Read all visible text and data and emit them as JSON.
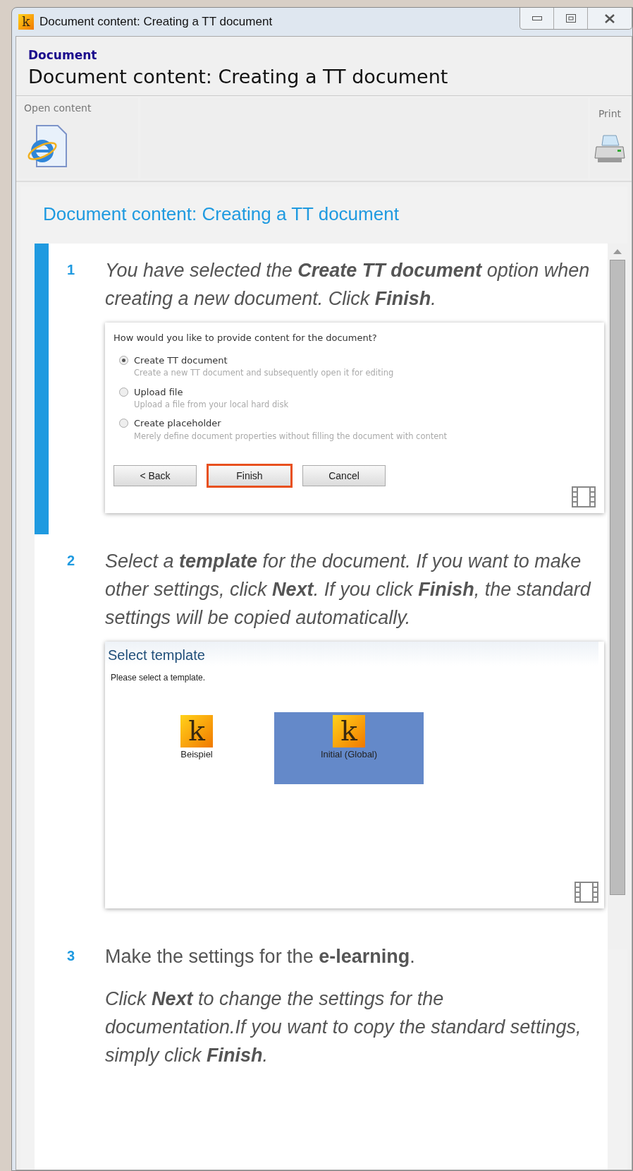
{
  "window": {
    "icon_letter": "k",
    "title": "Document content: Creating a TT document"
  },
  "header": {
    "category": "Document",
    "title": "Document content: Creating a TT document"
  },
  "toolbar": [
    {
      "kind": "open",
      "label": "Open content"
    },
    {
      "kind": "print",
      "label": "Print"
    }
  ],
  "page_title": "Document content: Creating a TT document",
  "steps": [
    {
      "number": "1",
      "active": true,
      "italic": true,
      "text": "You have selected the **Create TT document** option when creating a new document. Click **Finish**.",
      "screenshot": {
        "kind": "options",
        "question": "How would you like to provide content for the document?",
        "options": [
          {
            "label": "Create TT document",
            "description": "Create a new TT document and subsequently open it for editing",
            "selected": true
          },
          {
            "label": "Upload file",
            "description": "Upload a file from your local hard disk",
            "selected": false
          },
          {
            "label": "Create placeholder",
            "description": "Merely define document properties without filling the document with content",
            "selected": false
          }
        ],
        "buttons": [
          {
            "label": "< Back",
            "highlighted": false
          },
          {
            "label": "Finish",
            "highlighted": true
          },
          {
            "label": "Cancel",
            "highlighted": false
          }
        ]
      }
    },
    {
      "number": "2",
      "active": false,
      "italic": true,
      "text": "Select a **template** for the document. If you want to make other settings, click **Next**. If you click **Finish**, the standard settings will be copied automatically.",
      "screenshot": {
        "kind": "templates",
        "title": "Select template",
        "prompt": "Please select a template.",
        "templates": [
          {
            "icon_letter": "k",
            "label": "Beispiel",
            "selected": false
          },
          {
            "icon_letter": "k",
            "label": "Initial (Global)",
            "selected": true
          }
        ]
      }
    },
    {
      "number": "3",
      "active": false,
      "italic": false,
      "text": "Make the settings for the **e-learning**.",
      "note": "Click **Next** to change the settings for the documentation.If you want to copy the standard settings, simply click **Finish**."
    }
  ]
}
